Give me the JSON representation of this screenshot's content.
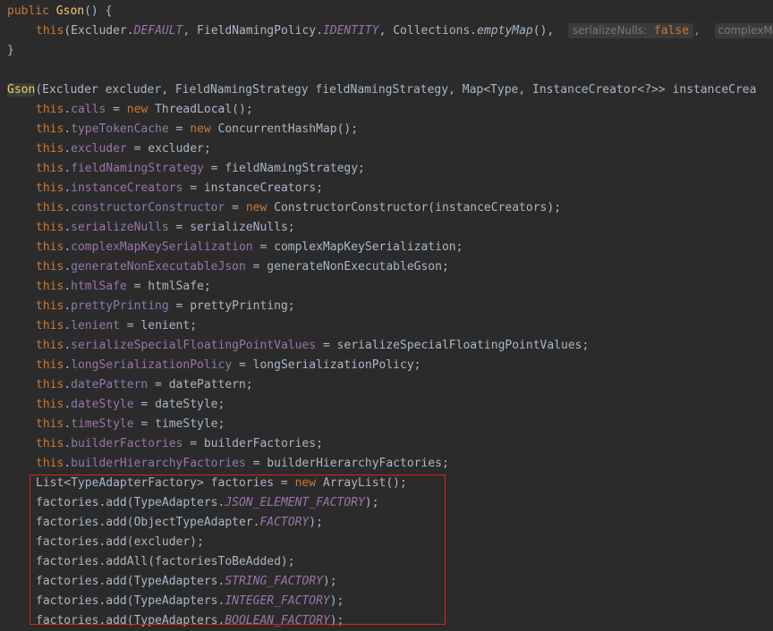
{
  "code": {
    "l1": {
      "kw": "public",
      "name": "Gson",
      "rest": "() {"
    },
    "l2": {
      "this": "this",
      "open": "(Excluder.",
      "c1": "DEFAULT",
      "mid1": ", FieldNamingPolicy.",
      "c2": "IDENTITY",
      "mid2": ", Collections.",
      "call": "emptyMap",
      "mid3": "(), ",
      "hint1_label": "serializeNulls:",
      "hint1_val": "false",
      "comma": ",",
      "hint2_label": "complexM"
    },
    "l3": "}",
    "l5": {
      "name": "Gson",
      "rest": "(Excluder excluder, FieldNamingStrategy fieldNamingStrategy, Map<Type, InstanceCreator<?>> instanceCrea"
    },
    "assign": [
      {
        "field": "calls",
        "eq": " = ",
        "new": "new",
        "rhs": " ThreadLocal();"
      },
      {
        "field": "typeTokenCache",
        "eq": " = ",
        "new": "new",
        "rhs": " ConcurrentHashMap();"
      },
      {
        "field": "excluder",
        "eq": " = excluder;"
      },
      {
        "field": "fieldNamingStrategy",
        "eq": " = fieldNamingStrategy;"
      },
      {
        "field": "instanceCreators",
        "eq": " = instanceCreators;"
      },
      {
        "field": "constructorConstructor",
        "eq": " = ",
        "new": "new",
        "rhs": " ConstructorConstructor(instanceCreators);"
      },
      {
        "field": "serializeNulls",
        "eq": " = serializeNulls;"
      },
      {
        "field": "complexMapKeySerialization",
        "eq": " = complexMapKeySerialization;"
      },
      {
        "field": "generateNonExecutableJson",
        "eq": " = generateNonExecutableGson;"
      },
      {
        "field": "htmlSafe",
        "eq": " = htmlSafe;"
      },
      {
        "field": "prettyPrinting",
        "eq": " = prettyPrinting;"
      },
      {
        "field": "lenient",
        "eq": " = lenient;"
      },
      {
        "field": "serializeSpecialFloatingPointValues",
        "eq": " = serializeSpecialFloatingPointValues;"
      },
      {
        "field": "longSerializationPolicy",
        "eq": " = longSerializationPolicy;"
      },
      {
        "field": "datePattern",
        "eq": " = datePattern;"
      },
      {
        "field": "dateStyle",
        "eq": " = dateStyle;"
      },
      {
        "field": "timeStyle",
        "eq": " = timeStyle;"
      },
      {
        "field": "builderFactories",
        "eq": " = builderFactories;"
      },
      {
        "field": "builderHierarchyFactories",
        "eq": " = builderHierarchyFactories;"
      }
    ],
    "this_kw": "this",
    "dot": ".",
    "list_decl": {
      "a": "List<TypeAdapterFactory> factories = ",
      "new": "new",
      "b": " ArrayList();"
    },
    "factories": [
      {
        "a": "factories.add(TypeAdapters.",
        "c": "JSON_ELEMENT_FACTORY",
        "b": ");"
      },
      {
        "a": "factories.add(ObjectTypeAdapter.",
        "c": "FACTORY",
        "b": ");"
      },
      {
        "a": "factories.add(excluder);"
      },
      {
        "a": "factories.addAll(factoriesToBeAdded);"
      },
      {
        "a": "factories.add(TypeAdapters.",
        "c": "STRING_FACTORY",
        "b": ");"
      },
      {
        "a": "factories.add(TypeAdapters.",
        "c": "INTEGER_FACTORY",
        "b": ");"
      },
      {
        "a": "factories.add(TypeAdapters.",
        "c": "BOOLEAN_FACTORY",
        "b": ");"
      }
    ]
  },
  "colors": {
    "background": "#2b2b2b",
    "keyword": "#cc7832",
    "field": "#9876aa",
    "method": "#ffc66d",
    "text": "#a9b7c6",
    "highlight_box": "#e02020"
  }
}
